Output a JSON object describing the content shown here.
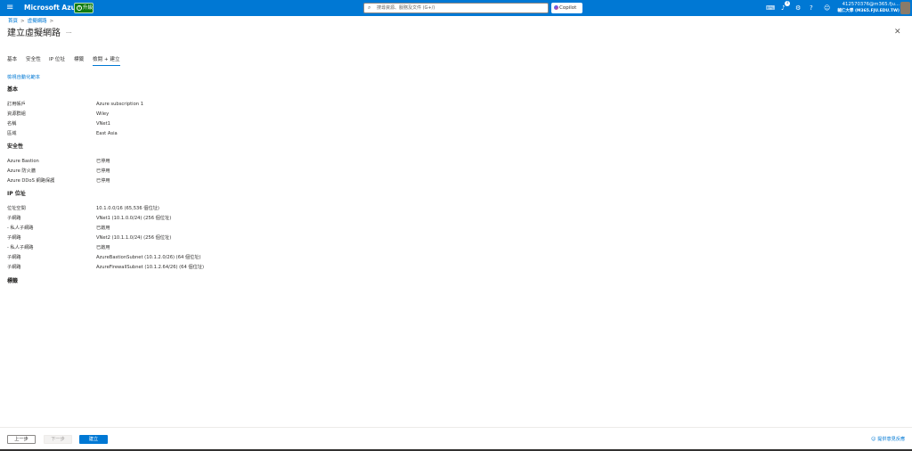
{
  "topbar": {
    "menu_icon": "hamburger-icon",
    "brand": "Microsoft Azure",
    "upgrade_label": "升級",
    "search_placeholder": "搜尋資源、服務及文件 (G+/)",
    "copilot_label": "Copilot",
    "notification_count": "1",
    "account_email": "412570376@m365.fju...",
    "account_tenant": "輔仁大學 (M365.FJU.EDU.TW)"
  },
  "breadcrumb": {
    "home": "首頁",
    "parent": "虛擬網路",
    "separator": ">"
  },
  "page": {
    "title": "建立虛擬網路",
    "more_label": "···",
    "close_label": "✕"
  },
  "tabs": [
    "基本",
    "安全性",
    "IP 位址",
    "標籤",
    "檢閱 + 建立"
  ],
  "automation_link": "檢視自動化範本",
  "basics": {
    "title": "基本",
    "rows": [
      {
        "label": "訂用帳戶",
        "value": "Azure subscription 1"
      },
      {
        "label": "資源群組",
        "value": "Wiley"
      },
      {
        "label": "名稱",
        "value": "VNet1"
      },
      {
        "label": "區域",
        "value": "East Asia"
      }
    ]
  },
  "security": {
    "title": "安全性",
    "rows": [
      {
        "label": "Azure Bastion",
        "value": "已停用"
      },
      {
        "label": "Azure 防火牆",
        "value": "已停用"
      },
      {
        "label": "Azure DDoS 網路保護",
        "value": "已停用"
      }
    ]
  },
  "ip": {
    "title": "IP 位址",
    "rows": [
      {
        "label": "位址空間",
        "value": "10.1.0.0/16 (65,536 個位址)"
      },
      {
        "label": "子網路",
        "value": "VNet1 (10.1.0.0/24) (256 個位址)"
      },
      {
        "label": "- 私人子網路",
        "value": "已啟用"
      },
      {
        "label": "子網路",
        "value": "VNet2 (10.1.1.0/24) (256 個位址)"
      },
      {
        "label": "- 私人子網路",
        "value": "已啟用"
      },
      {
        "label": "子網路",
        "value": "AzureBastionSubnet (10.1.2.0/26) (64 個位址)"
      },
      {
        "label": "子網路",
        "value": "AzureFirewallSubnet (10.1.2.64/26) (64 個位址)"
      }
    ]
  },
  "tags": {
    "title": "標籤"
  },
  "footer": {
    "prev_label": "上一步",
    "next_label": "下一步",
    "create_label": "建立",
    "feedback_label": "提供意見反應"
  },
  "colors": {
    "accent": "#0078d4",
    "upgrade_green": "#107c10"
  }
}
